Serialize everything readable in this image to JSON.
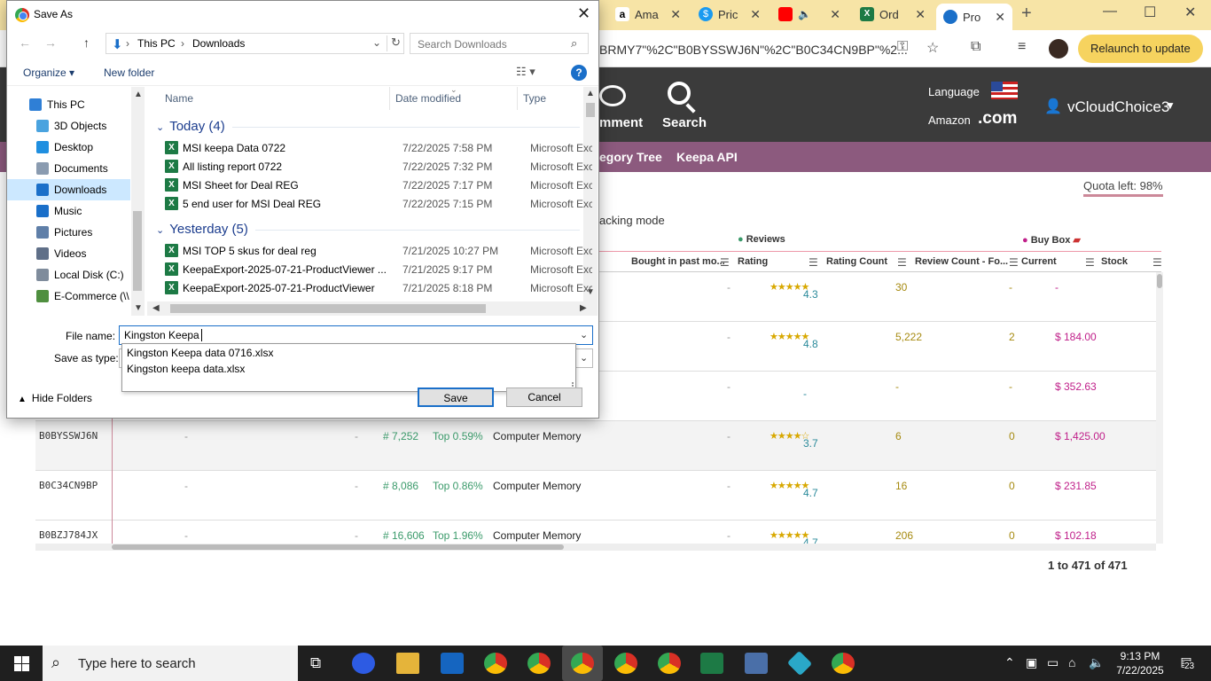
{
  "browser": {
    "tabs": [
      {
        "label": "Ama",
        "color": "#ffffff"
      },
      {
        "label": "Pric",
        "color": "#1a9af0"
      },
      {
        "label": "",
        "color": "#ff0000"
      },
      {
        "label": "Ord",
        "color": "#1d7a45"
      },
      {
        "label": "Pro",
        "color": "#1a6fc9"
      }
    ],
    "url_text": "BRMY7\"%2C\"B0BYSSWJ6N\"%2C\"B0C34CN9BP\"%2...",
    "relaunch_label": "Relaunch to update"
  },
  "keepa": {
    "nav_comment": "mment",
    "nav_search": "Search",
    "language_label": "Language",
    "amazon_label": "Amazon",
    "domain": ".com",
    "username": "vCloudChoice3",
    "subnav": [
      "egory Tree",
      "Keepa API"
    ],
    "quota": "Quota left: 98%",
    "tracking_mode": "acking mode",
    "group_reviews": "Reviews",
    "group_buybox": "Buy Box",
    "columns": [
      "Bought in past mo...",
      "Rating",
      "Rating Count",
      "Review Count - Fo...",
      "Current",
      "Stock"
    ],
    "rows": [
      {
        "asin": "",
        "c1": "",
        "c2": "",
        "rank": "",
        "top": "",
        "cat": "",
        "bought": "-",
        "stars": "★★★★★",
        "rating": "4.3",
        "rcount": "30",
        "revcount": "-",
        "price": "-"
      },
      {
        "asin": "",
        "c1": "",
        "c2": "",
        "rank": "",
        "top": "",
        "cat": "",
        "bought": "-",
        "stars": "★★★★★",
        "rating": "4.8",
        "rcount": "5,222",
        "revcount": "2",
        "price": "$ 184.00"
      },
      {
        "asin": "",
        "c1": "",
        "c2": "",
        "rank": "",
        "top": "",
        "cat": "",
        "bought": "-",
        "stars": "",
        "rating": "-",
        "rcount": "-",
        "revcount": "-",
        "price": "$ 352.63"
      },
      {
        "asin": "B0BYSSWJ6N",
        "c1": "-",
        "c2": "-",
        "rank": "# 7,252",
        "top": "Top 0.59%",
        "cat": "Computer Memory",
        "bought": "-",
        "stars": "★★★★☆",
        "rating": "3.7",
        "rcount": "6",
        "revcount": "0",
        "price": "$ 1,425.00"
      },
      {
        "asin": "B0C34CN9BP",
        "c1": "-",
        "c2": "-",
        "rank": "# 8,086",
        "top": "Top 0.86%",
        "cat": "Computer Memory",
        "bought": "-",
        "stars": "★★★★★",
        "rating": "4.7",
        "rcount": "16",
        "revcount": "0",
        "price": "$ 231.85"
      },
      {
        "asin": "B0BZJ784JX",
        "c1": "-",
        "c2": "-",
        "rank": "# 16,606",
        "top": "Top 1.96%",
        "cat": "Computer Memory",
        "bought": "-",
        "stars": "★★★★★",
        "rating": "4.7",
        "rcount": "206",
        "revcount": "0",
        "price": "$ 102.18"
      }
    ],
    "pager": "1 to 471 of 471"
  },
  "dialog": {
    "title": "Save As",
    "breadcrumb": [
      "This PC",
      "Downloads"
    ],
    "search_placeholder": "Search Downloads",
    "organize": "Organize ▾",
    "new_folder": "New folder",
    "help": "?",
    "nav_items": [
      {
        "label": "This PC",
        "icon": "computer-icon",
        "color": "#2f7fd6"
      },
      {
        "label": "3D Objects",
        "icon": "cube-icon",
        "color": "#4aa3df"
      },
      {
        "label": "Desktop",
        "icon": "desktop-icon",
        "color": "#1f8fe0"
      },
      {
        "label": "Documents",
        "icon": "document-icon",
        "color": "#8a9bb0"
      },
      {
        "label": "Downloads",
        "icon": "download-icon",
        "color": "#1a6fc9"
      },
      {
        "label": "Music",
        "icon": "music-icon",
        "color": "#1a6fc9"
      },
      {
        "label": "Pictures",
        "icon": "picture-icon",
        "color": "#5f7fa8"
      },
      {
        "label": "Videos",
        "icon": "video-icon",
        "color": "#5f6f88"
      },
      {
        "label": "Local Disk (C:)",
        "icon": "disk-icon",
        "color": "#7f8c9c"
      },
      {
        "label": "E-Commerce (\\\\",
        "icon": "network-drive-icon",
        "color": "#4f8f3f"
      }
    ],
    "col_name": "Name",
    "col_date": "Date modified",
    "col_type": "Type",
    "groups": [
      {
        "label": "Today (4)",
        "files": [
          {
            "name": "MSI keepa Data 0722",
            "date": "7/22/2025 7:58 PM",
            "type": "Microsoft Excel"
          },
          {
            "name": "All listing report 0722",
            "date": "7/22/2025 7:32 PM",
            "type": "Microsoft Excel"
          },
          {
            "name": "MSI Sheet for Deal REG",
            "date": "7/22/2025 7:17 PM",
            "type": "Microsoft Excel"
          },
          {
            "name": "5 end user for MSI Deal REG",
            "date": "7/22/2025 7:15 PM",
            "type": "Microsoft Excel"
          }
        ]
      },
      {
        "label": "Yesterday (5)",
        "files": [
          {
            "name": "MSI TOP 5 skus for deal reg",
            "date": "7/21/2025 10:27 PM",
            "type": "Microsoft Excel"
          },
          {
            "name": "KeepaExport-2025-07-21-ProductViewer ...",
            "date": "7/21/2025 9:17 PM",
            "type": "Microsoft Excel"
          },
          {
            "name": "KeepaExport-2025-07-21-ProductViewer",
            "date": "7/21/2025 8:18 PM",
            "type": "Microsoft Excel"
          }
        ]
      }
    ],
    "file_name_label": "File name:",
    "file_name_value": "Kingston Keepa",
    "save_type_label": "Save as type:",
    "suggestions": [
      "Kingston Keepa data 0716.xlsx",
      "Kingston keepa data.xlsx"
    ],
    "hide_folders": "Hide Folders",
    "save": "Save",
    "cancel": "Cancel"
  },
  "taskbar": {
    "search_placeholder": "Type here to search",
    "time": "9:13 PM",
    "date": "7/22/2025",
    "notif_count": "23"
  }
}
